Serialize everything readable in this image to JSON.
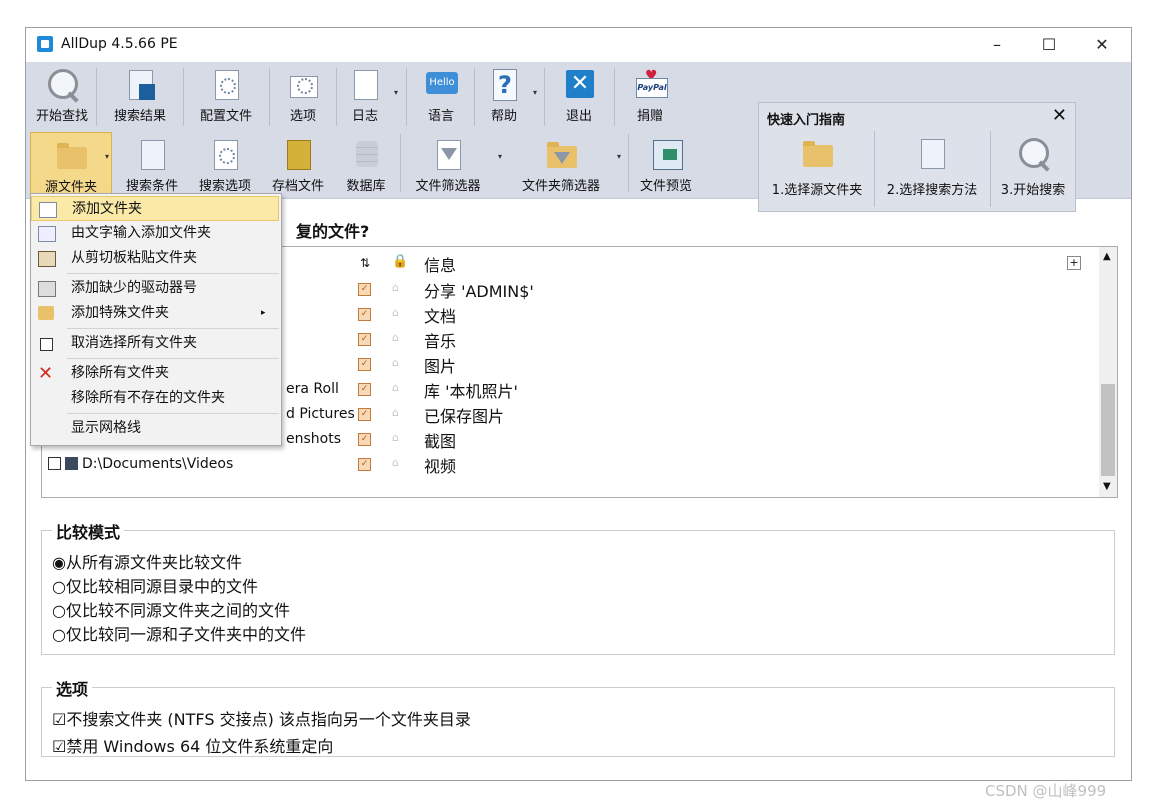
{
  "window": {
    "title": "AllDup 4.5.66 PE"
  },
  "toolbar_top": [
    {
      "label": "开始查找"
    },
    {
      "label": "搜索结果"
    },
    {
      "label": "配置文件"
    },
    {
      "label": "选项"
    },
    {
      "label": "日志"
    },
    {
      "label": "语言",
      "icon_text": "Hello"
    },
    {
      "label": "帮助"
    },
    {
      "label": "退出"
    },
    {
      "label": "捐赠",
      "icon_text": "PayPal"
    }
  ],
  "toolbar_bottom": [
    {
      "label": "源文件夹"
    },
    {
      "label": "搜索条件"
    },
    {
      "label": "搜索选项"
    },
    {
      "label": "存档文件"
    },
    {
      "label": "数据库"
    },
    {
      "label": "文件筛选器"
    },
    {
      "label": "文件夹筛选器"
    },
    {
      "label": "文件预览"
    }
  ],
  "quick_start": {
    "title": "快速入门指南",
    "steps": [
      "1.选择源文件夹",
      "2.选择搜索方法",
      "3.开始搜索"
    ]
  },
  "heading": "复的文件?",
  "folder_list": {
    "info_header": "信息",
    "rows": [
      {
        "path": "",
        "info": "分享 'ADMIN$'"
      },
      {
        "path": "",
        "info": "文档"
      },
      {
        "path": "",
        "info": "音乐"
      },
      {
        "path": "",
        "info": "图片"
      },
      {
        "path": "era Roll",
        "info": "库 '本机照片'"
      },
      {
        "path": "d Pictures",
        "info": "已保存图片"
      },
      {
        "path": "enshots",
        "info": "截图"
      },
      {
        "path": "D:\\Documents\\Videos",
        "info": "视频"
      }
    ]
  },
  "compare_mode": {
    "title": "比较模式",
    "options": [
      "◉从所有源文件夹比较文件",
      "○仅比较相同源目录中的文件",
      "○仅比较不同源文件夹之间的文件",
      "○仅比较同一源和子文件夹中的文件"
    ]
  },
  "options": {
    "title": "选项",
    "items": [
      "☑不搜索文件夹 (NTFS 交接点) 该点指向另一个文件夹目录",
      "☑禁用 Windows 64 位文件系统重定向"
    ]
  },
  "context_menu": {
    "items": [
      "添加文件夹",
      "由文字输入添加文件夹",
      "从剪切板粘贴文件夹",
      "添加缺少的驱动器号",
      "添加特殊文件夹",
      "取消选择所有文件夹",
      "移除所有文件夹",
      "移除所有不存在的文件夹",
      "显示网格线"
    ]
  },
  "watermark": "CSDN @山峰999",
  "colors": {
    "ribbon": "#d6dbe6",
    "menu_highlight": "#fbe9a7",
    "accent": "#1f8ad6"
  }
}
